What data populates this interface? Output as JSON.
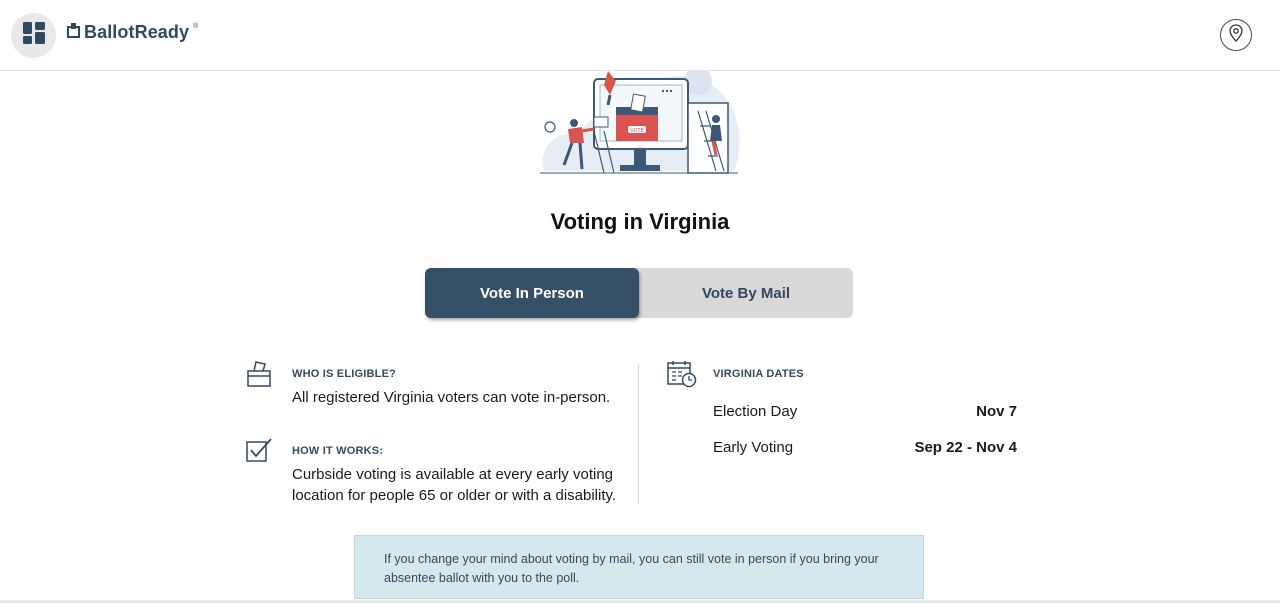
{
  "header": {
    "menu_icon": "dashboard-grid-icon",
    "logo_icon": "ballot-box-icon",
    "logo_text": "BallotReady",
    "logo_reg": "®",
    "location_icon": "map-pin-icon"
  },
  "hero": {
    "illustration": "voting-illustration"
  },
  "page": {
    "title": "Voting in Virginia"
  },
  "tabs": [
    {
      "label": "Vote In Person",
      "active": true
    },
    {
      "label": "Vote By Mail",
      "active": false
    }
  ],
  "eligibility": {
    "icon": "ballot-box-icon",
    "label": "WHO IS ELIGIBLE?",
    "text": "All registered Virginia voters can vote in-person."
  },
  "how_it_works": {
    "icon": "checkbox-icon",
    "label": "HOW IT WORKS:",
    "text_line1": "Curbside voting is available at every early voting",
    "text_line2": "location for people 65 or older or with a disability."
  },
  "dates": {
    "icon": "calendar-clock-icon",
    "label": "VIRGINIA DATES",
    "rows": [
      {
        "name": "Election Day",
        "value": "Nov 7"
      },
      {
        "name": "Early Voting",
        "value": "Sep 22 - Nov 4"
      }
    ]
  },
  "notice": {
    "line1": "If you change your mind about voting by mail, you can still vote in person if you bring your",
    "line2": "absentee ballot with you to the poll."
  },
  "colors": {
    "brand": "#2e4a5e",
    "active_tab": "#354f66",
    "inactive_tab": "#d9d9d9",
    "notice_bg": "#d5e9ed",
    "accent_red": "#d9534f"
  }
}
